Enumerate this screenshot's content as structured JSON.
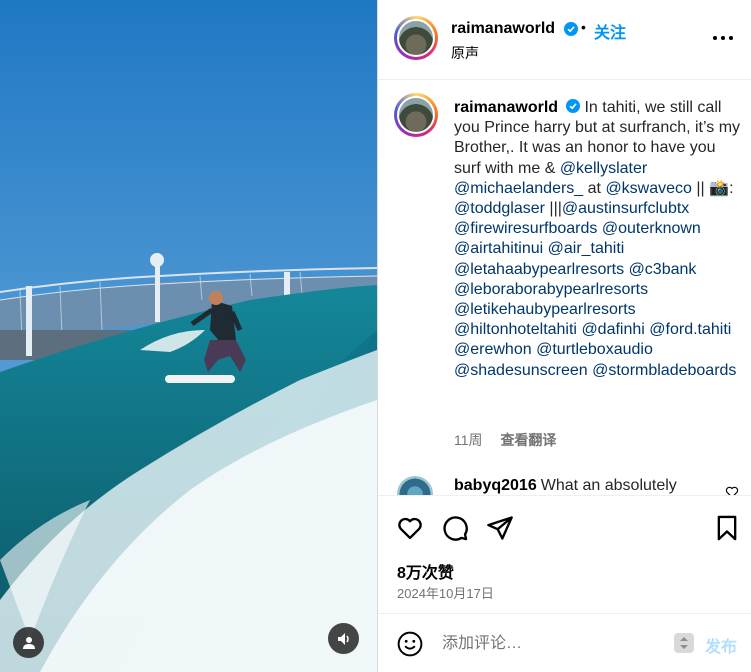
{
  "post": {
    "username": "raimanaworld",
    "verified": true,
    "follow_label": "关注",
    "dot": "•",
    "audio_label": "原声"
  },
  "caption": {
    "username": "raimanaworld",
    "lines": [
      {
        "type": "text",
        "value": "In tahiti, we still call you Prince harry but at surfranch, it’s my Brother,. It was an honor to have you surf with me & "
      },
      {
        "type": "mention",
        "value": "@kellyslater"
      },
      {
        "type": "text",
        "value": " "
      },
      {
        "type": "mention",
        "value": "@michaelanders_"
      },
      {
        "type": "text",
        "value": " at "
      },
      {
        "type": "mention",
        "value": "@kswaveco"
      },
      {
        "type": "text",
        "value": " || 📸: "
      },
      {
        "type": "mention",
        "value": "@toddglaser"
      },
      {
        "type": "text",
        "value": " |||"
      },
      {
        "type": "mention",
        "value": "@austinsurfclubtx"
      },
      {
        "type": "text",
        "value": " "
      },
      {
        "type": "mention",
        "value": "@firewiresurfboards"
      },
      {
        "type": "text",
        "value": " "
      },
      {
        "type": "mention",
        "value": "@outerknown"
      },
      {
        "type": "text",
        "value": " "
      },
      {
        "type": "mention",
        "value": "@airtahitinui"
      },
      {
        "type": "text",
        "value": " "
      },
      {
        "type": "mention",
        "value": "@air_tahiti"
      },
      {
        "type": "text",
        "value": " "
      },
      {
        "type": "mention",
        "value": "@letahaabypearlresorts"
      },
      {
        "type": "text",
        "value": " "
      },
      {
        "type": "mention",
        "value": "@c3bank"
      },
      {
        "type": "text",
        "value": " "
      },
      {
        "type": "mention",
        "value": "@leboraborabypearlresorts"
      },
      {
        "type": "text",
        "value": " "
      },
      {
        "type": "mention",
        "value": "@letikehaubypearlresorts"
      },
      {
        "type": "text",
        "value": " "
      },
      {
        "type": "mention",
        "value": "@hiltonhoteltahiti"
      },
      {
        "type": "text",
        "value": " "
      },
      {
        "type": "mention",
        "value": "@dafinhi"
      },
      {
        "type": "text",
        "value": " "
      },
      {
        "type": "mention",
        "value": "@ford.tahiti"
      },
      {
        "type": "text",
        "value": " "
      },
      {
        "type": "mention",
        "value": "@erewhon"
      },
      {
        "type": "text",
        "value": " "
      },
      {
        "type": "mention",
        "value": "@turtleboxaudio"
      },
      {
        "type": "text",
        "value": " "
      },
      {
        "type": "mention",
        "value": "@shadesunscreen"
      },
      {
        "type": "text",
        "value": " "
      },
      {
        "type": "mention",
        "value": "@stormbladeboards"
      }
    ],
    "age": "11周",
    "translate_label": "查看翻译"
  },
  "comment": {
    "username": "babyq2016",
    "text": "What an absolutely"
  },
  "stats": {
    "likes": "8万次赞",
    "date": "2024年10月17日"
  },
  "composer": {
    "placeholder": "添加评论…",
    "post_label": "发布"
  },
  "colors": {
    "accent": "#0095f6",
    "mention": "#00376b",
    "muted": "#737373",
    "post_disabled": "#b2dffc"
  },
  "icons": [
    "verified-badge-icon",
    "more-options-icon",
    "heart-icon",
    "comment-icon",
    "share-icon",
    "bookmark-icon",
    "emoji-icon",
    "user-icon",
    "sound-icon"
  ]
}
